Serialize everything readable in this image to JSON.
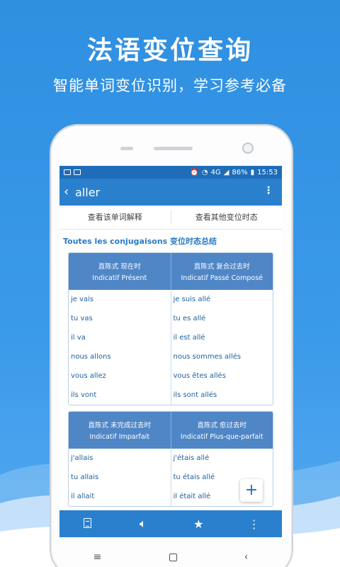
{
  "promo": {
    "title": "法语变位查询",
    "subtitle": "智能单词变位识别，学习参考必备"
  },
  "status": {
    "network": "4G",
    "battery": "86%",
    "time": "15:53"
  },
  "appbar": {
    "title": "aller"
  },
  "tabs": {
    "definition": "查看该单词解释",
    "other_tenses": "查看其他变位时态"
  },
  "section_title": "Toutes les conjugaisons 变位时态总结",
  "tables": [
    {
      "left_header_cn": "直陈式 现在时",
      "left_header_fr": "Indicatif Présent",
      "right_header_cn": "直陈式 复合过去时",
      "right_header_fr": "Indicatif Passé Composé",
      "left": [
        "je vais",
        "tu vas",
        "il va",
        "nous allons",
        "vous allez",
        "ils vont"
      ],
      "right": [
        "je suis allé",
        "tu es allé",
        "il est allé",
        "nous sommes allés",
        "vous êtes allés",
        "ils sont allés"
      ]
    },
    {
      "left_header_cn": "直陈式 未完成过去时",
      "left_header_fr": "Indicatif Imparfait",
      "right_header_cn": "直陈式 愈过去时",
      "right_header_fr": "Indicatif Plus-que-parfait",
      "left": [
        "j'allais",
        "tu allais",
        "il allait"
      ],
      "right": [
        "j'étais allé",
        "tu étais allé",
        "il était allé"
      ]
    }
  ],
  "colors": {
    "accent": "#2a80cc",
    "table_header": "#4f86c6",
    "conjugation_text": "#1f5f9c"
  },
  "icons": {
    "back": "chevron-left-icon",
    "more": "more-vertical-icon",
    "add": "plus-icon",
    "bottom": [
      "book-icon",
      "speaker-icon",
      "star-icon",
      "more-vertical-icon"
    ],
    "nav": [
      "menu-icon",
      "home-icon",
      "back-icon"
    ]
  }
}
